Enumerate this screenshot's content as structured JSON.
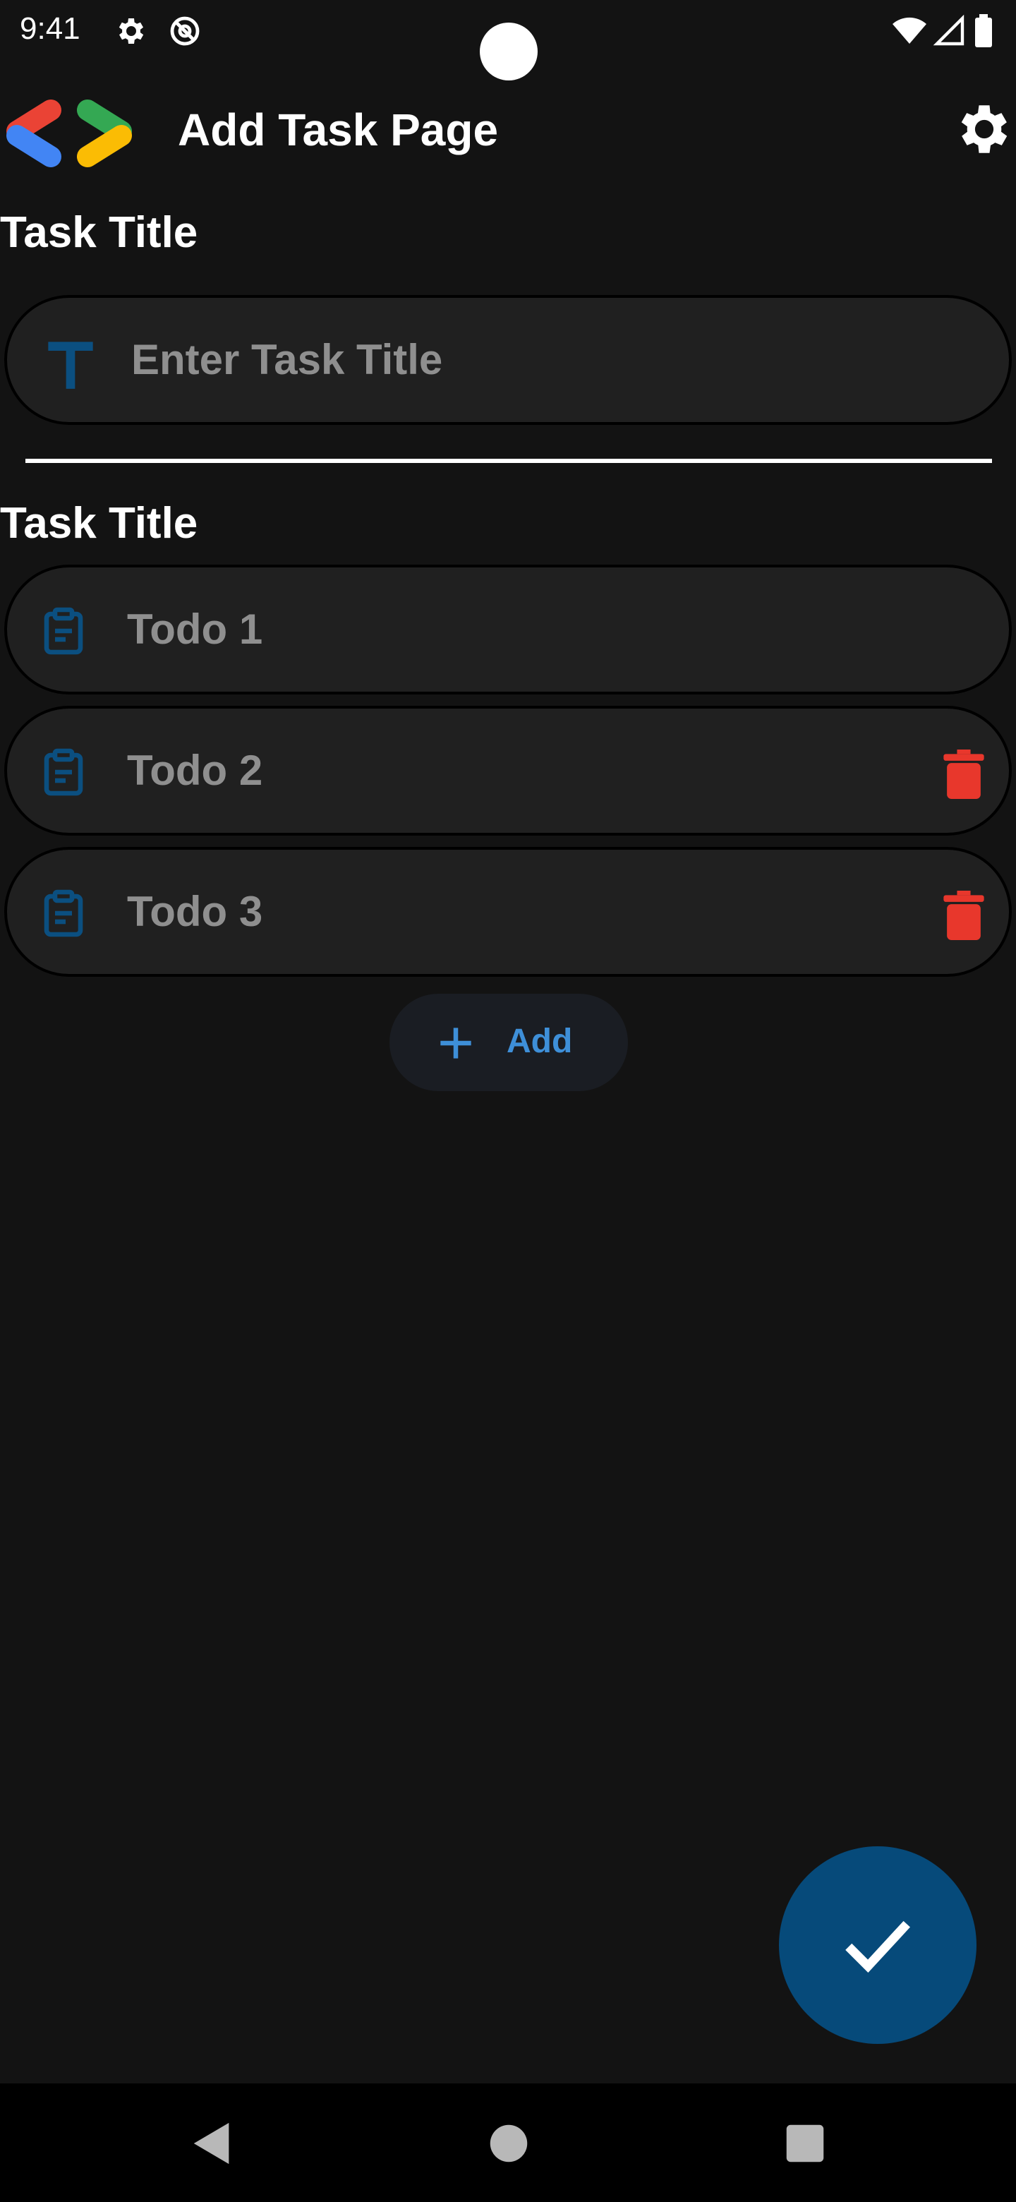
{
  "status_bar": {
    "time": "9:41",
    "icons": [
      "gear-icon",
      "at-sign-icon",
      "wifi-icon",
      "signal-icon",
      "battery-icon"
    ]
  },
  "app_bar": {
    "title": "Add Task Page",
    "logo": "dev-logo",
    "settings_icon": "gear-icon"
  },
  "title_section": {
    "label": "Task Title",
    "input_placeholder": "Enter Task Title",
    "input_value": "",
    "input_icon": "text-t-icon"
  },
  "todo_section": {
    "label": "Task Title",
    "items": [
      {
        "label": "Todo 1",
        "icon": "clipboard-icon",
        "deletable": false
      },
      {
        "label": "Todo 2",
        "icon": "clipboard-icon",
        "deletable": true
      },
      {
        "label": "Todo 3",
        "icon": "clipboard-icon",
        "deletable": true
      }
    ],
    "add_button": {
      "label": "Add",
      "icon": "plus-icon"
    }
  },
  "fab": {
    "icon": "check-icon"
  },
  "nav_bar": {
    "icons": [
      "back-icon",
      "home-icon",
      "recents-icon"
    ]
  },
  "colors": {
    "background": "#131313",
    "pill_background": "#202020",
    "accent_blue": "#064a7a",
    "link_blue": "#3e8fd8",
    "danger_red": "#e8372c",
    "muted_text": "#8f8f8f"
  }
}
